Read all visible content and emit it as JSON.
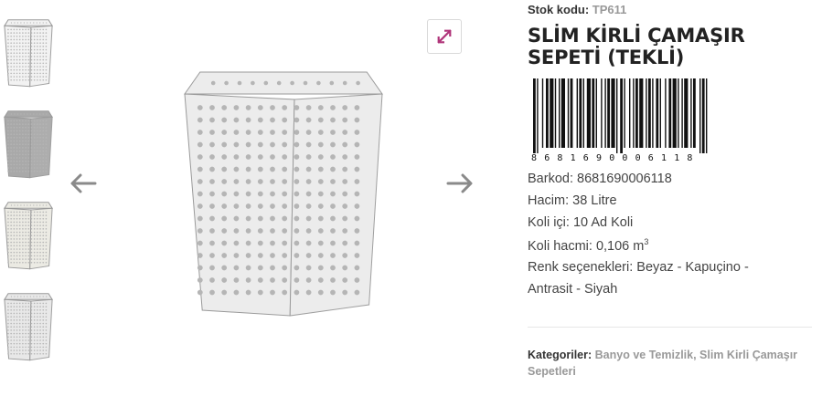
{
  "gallery": {
    "thumbnails": [
      {
        "alt": "Beyaz",
        "color": "#f2f2f2"
      },
      {
        "alt": "Kapuçino",
        "color": "#a9a9a9"
      },
      {
        "alt": "Antrasit",
        "color": "#ebeae3"
      },
      {
        "alt": "Siyah",
        "color": "#e8e8e8"
      }
    ],
    "prev_icon": "arrow-left-icon",
    "next_icon": "arrow-right-icon",
    "expand_icon": "expand-icon"
  },
  "product": {
    "sku_label": "Stok kodu:",
    "sku_value": "TP611",
    "title": "SLİM KİRLİ ÇAMAŞIR SEPETİ (TEKLİ)",
    "barcode_digits": [
      "8",
      "6",
      "8",
      "1",
      "6",
      "9",
      "0",
      "0",
      "0",
      "6",
      "1",
      "1",
      "8"
    ],
    "barcode": "Barkod: 8681690006118",
    "volume": "Hacim: 38 Litre",
    "box_qty": "Koli içi: 10 Ad Koli",
    "box_volume_text": "Koli hacmi: 0,106 m",
    "box_volume_sup": "3",
    "colors_line1": "Renk seçenekleri: Beyaz - Kapuçino -",
    "colors_line2": "Antrasit - Siyah"
  },
  "categories": {
    "label": "Kategoriler:",
    "items": [
      "Banyo ve Temizlik,",
      "Slim Kirli Çamaşır Sepetleri"
    ]
  },
  "colors": {
    "accent": "#b0357a",
    "arrow": "#8a8a8a",
    "basket": "#ececec"
  }
}
